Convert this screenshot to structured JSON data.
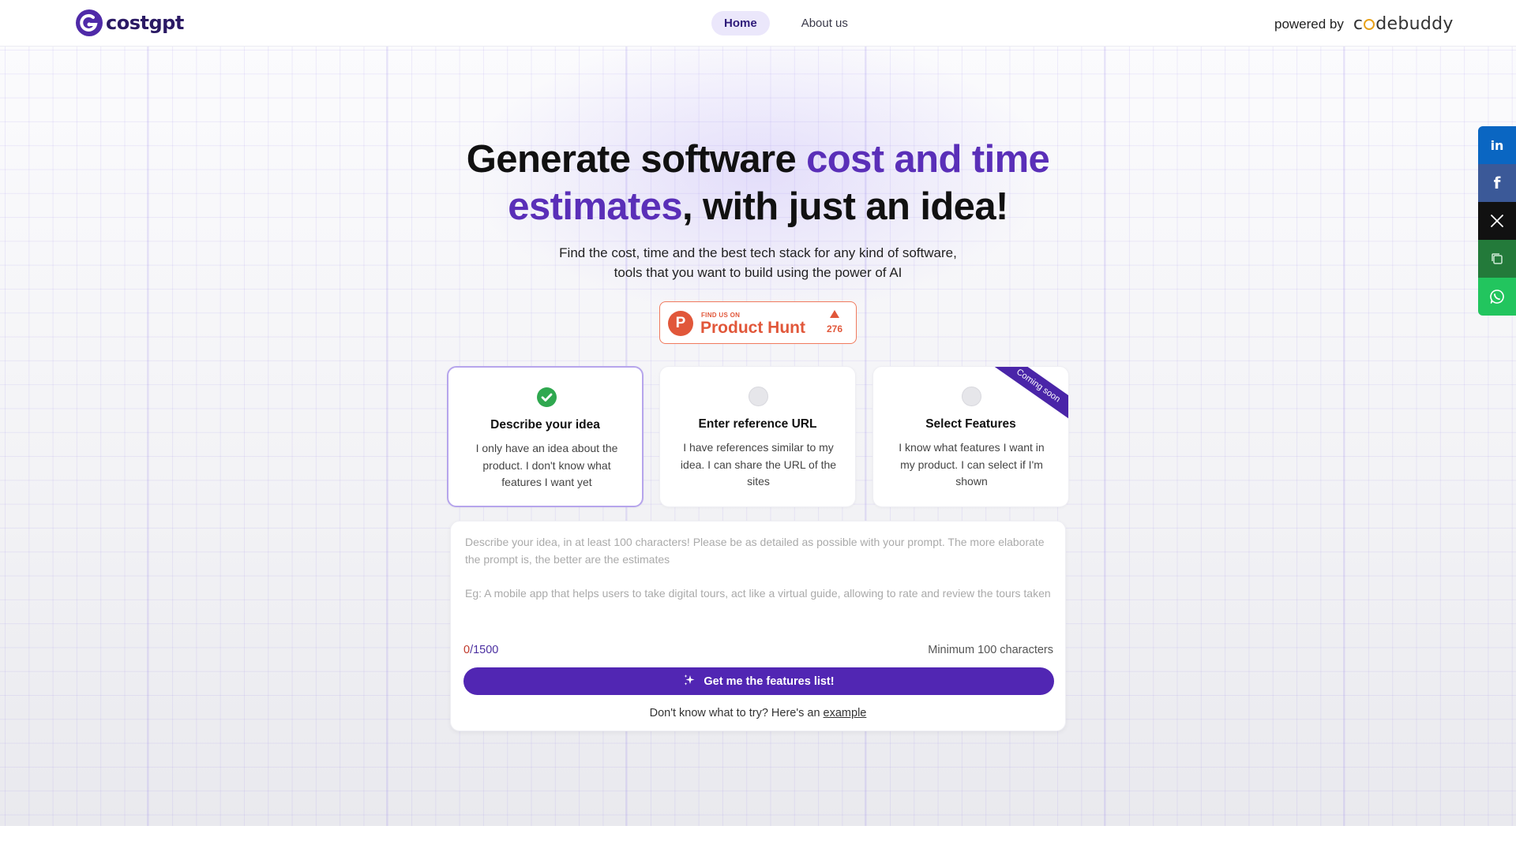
{
  "header": {
    "logo_text": "costgpt",
    "nav": [
      {
        "label": "Home",
        "active": true
      },
      {
        "label": "About us",
        "active": false
      }
    ],
    "powered_by_label": "powered by",
    "partner_logo_text": "codebuddy"
  },
  "hero": {
    "headline_part1": "Generate software ",
    "headline_accent1": "cost and time estimates",
    "headline_part2": ", with just an idea!",
    "subline_line1": "Find the cost, time and the best tech stack for any kind of software,",
    "subline_line2": "tools that you want to build using the power of AI"
  },
  "product_hunt": {
    "small_label": "FIND US ON",
    "name": "Product Hunt",
    "letter": "P",
    "upvotes": "276"
  },
  "options": [
    {
      "title": "Describe your idea",
      "description": "I only have an idea about the product. I don't know what features I want yet",
      "selected": true
    },
    {
      "title": "Enter reference URL",
      "description": "I have references similar to my idea. I can share the URL of the sites",
      "selected": false
    },
    {
      "title": "Select Features",
      "description": "I know what features I want in my product. I can select if I'm shown",
      "selected": false,
      "ribbon": "Coming soon"
    }
  ],
  "idea_form": {
    "placeholder_line1": "Describe your idea, in at least 100 characters! Please be as detailed as possible with your prompt. The more elaborate the prompt is, the better are the estimates",
    "placeholder_line2": "Eg: A mobile app that helps users to take digital tours, act like a virtual guide, allowing to rate and review the tours taken",
    "count_current": "0",
    "count_max": "/1500",
    "min_label": "Minimum 100 characters",
    "cta_label": "Get me the features list!",
    "hint_text": "Don't know what to try? Here's an ",
    "hint_link": "example"
  },
  "share": {
    "icons": [
      "linkedin-icon",
      "facebook-icon",
      "x-icon",
      "copy-icon",
      "whatsapp-icon"
    ],
    "colors": {
      "linkedin": "#0a66c2",
      "facebook": "#3b5998",
      "x": "#111111",
      "copy": "#237a3a",
      "whatsapp": "#22c55e"
    }
  },
  "colors": {
    "brand": "#5126b3",
    "accent_text": "#5a2fb8",
    "product_hunt": "#e1573a",
    "check": "#2fa84f"
  }
}
